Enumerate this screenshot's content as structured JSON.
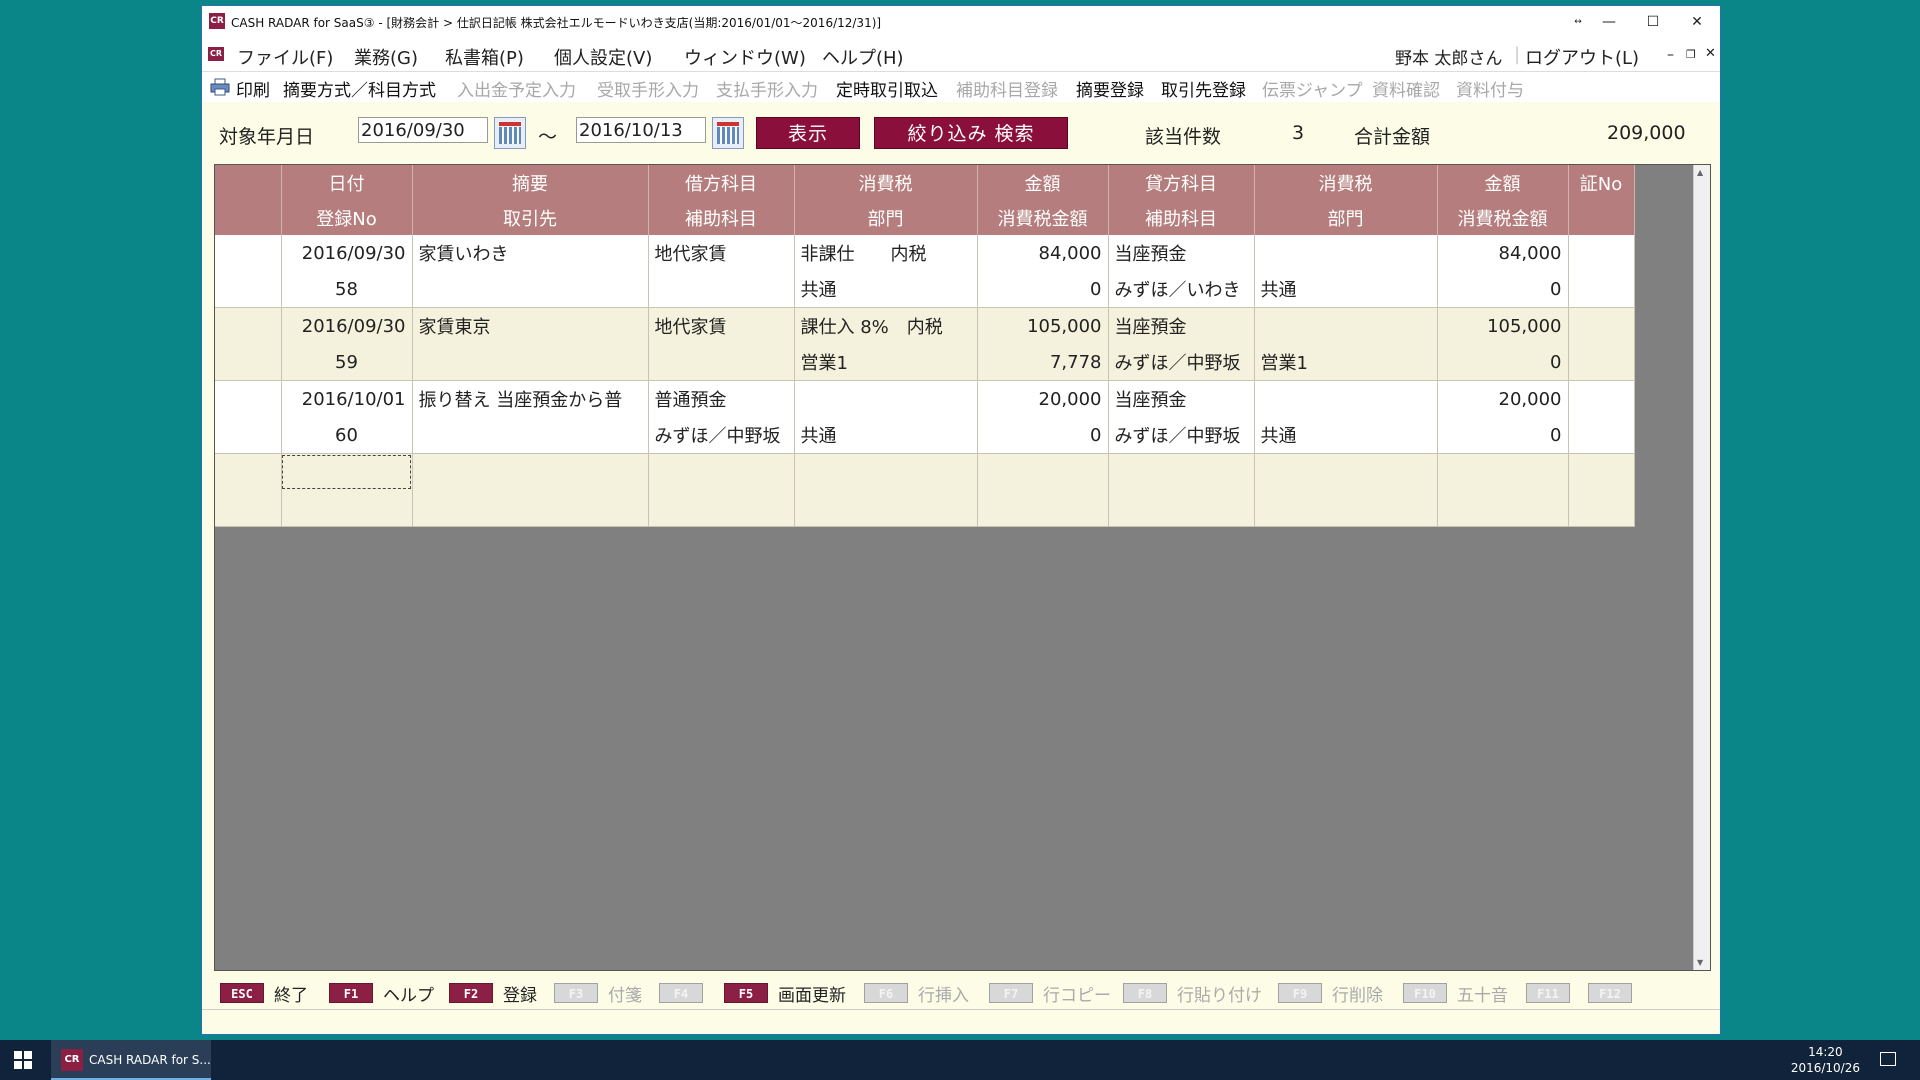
{
  "window": {
    "title": "CASH RADAR for SaaS③ - [財務会計 > 仕訳日記帳 株式会社エルモードいわき支店(当期:2016/01/01～2016/12/31)]",
    "app_icon": "CR"
  },
  "menu": {
    "items": [
      "ファイル(F)",
      "業務(G)",
      "私書箱(P)",
      "個人設定(V)",
      "ウィンドウ(W)",
      "ヘルプ(H)"
    ],
    "user": "野本 太郎さん",
    "logout": "ログアウト(L)"
  },
  "toolbar": {
    "print": "印刷",
    "items": [
      {
        "label": "摘要方式／科目方式",
        "enabled": true
      },
      {
        "label": "入出金予定入力",
        "enabled": false
      },
      {
        "label": "受取手形入力",
        "enabled": false
      },
      {
        "label": "支払手形入力",
        "enabled": false
      },
      {
        "label": "定時取引取込",
        "enabled": true
      },
      {
        "label": "補助科目登録",
        "enabled": false
      },
      {
        "label": "摘要登録",
        "enabled": true
      },
      {
        "label": "取引先登録",
        "enabled": true
      },
      {
        "label": "伝票ジャンプ",
        "enabled": false
      },
      {
        "label": "資料確認",
        "enabled": false
      },
      {
        "label": "資料付与",
        "enabled": false
      }
    ]
  },
  "filter": {
    "label": "対象年月日",
    "from": "2016/09/30",
    "tilde": "～",
    "to": "2016/10/13",
    "show_button": "表示",
    "search_button": "絞り込み 検索",
    "count_label": "該当件数",
    "count_value": "3",
    "total_label": "合計金額",
    "total_value": "209,000"
  },
  "table": {
    "header_top": [
      "",
      "日付",
      "摘要",
      "借方科目",
      "消費税",
      "金額",
      "貸方科目",
      "消費税",
      "金額",
      "証No"
    ],
    "header_bottom": [
      "",
      "登録No",
      "取引先",
      "補助科目",
      "部門",
      "消費税金額",
      "補助科目",
      "部門",
      "消費税金額",
      ""
    ],
    "rows": [
      {
        "top": [
          "",
          "2016/09/30",
          "家賃いわき",
          "地代家賃",
          "非課仕　　内税",
          "84,000",
          "当座預金",
          "",
          "84,000",
          ""
        ],
        "bottom": [
          "",
          "58",
          "",
          "",
          "共通",
          "0",
          "みずほ／いわき",
          "共通",
          "0",
          ""
        ]
      },
      {
        "top": [
          "",
          "2016/09/30",
          "家賃東京",
          "地代家賃",
          "課仕入 8%　内税",
          "105,000",
          "当座預金",
          "",
          "105,000",
          ""
        ],
        "bottom": [
          "",
          "59",
          "",
          "",
          "営業1",
          "7,778",
          "みずほ／中野坂",
          "営業1",
          "0",
          ""
        ]
      },
      {
        "top": [
          "",
          "2016/10/01",
          "振り替え 当座預金から普",
          "普通預金",
          "",
          "20,000",
          "当座預金",
          "",
          "20,000",
          ""
        ],
        "bottom": [
          "",
          "60",
          "",
          "みずほ／中野坂",
          "共通",
          "0",
          "みずほ／中野坂",
          "共通",
          "0",
          ""
        ]
      }
    ]
  },
  "fkeys": [
    {
      "key": "ESC",
      "label": "終了",
      "enabled": true
    },
    {
      "key": "F1",
      "label": "ヘルプ",
      "enabled": true
    },
    {
      "key": "F2",
      "label": "登録",
      "enabled": true
    },
    {
      "key": "F3",
      "label": "付箋",
      "enabled": false
    },
    {
      "key": "F4",
      "label": "",
      "enabled": false
    },
    {
      "key": "F5",
      "label": "画面更新",
      "enabled": true
    },
    {
      "key": "F6",
      "label": "行挿入",
      "enabled": false
    },
    {
      "key": "F7",
      "label": "行コピー",
      "enabled": false
    },
    {
      "key": "F8",
      "label": "行貼り付け",
      "enabled": false
    },
    {
      "key": "F9",
      "label": "行削除",
      "enabled": false
    },
    {
      "key": "F10",
      "label": "五十音",
      "enabled": false
    },
    {
      "key": "F11",
      "label": "",
      "enabled": false
    },
    {
      "key": "F12",
      "label": "",
      "enabled": false
    }
  ],
  "taskbar": {
    "app_label": "CASH RADAR for S...",
    "app_icon": "CR",
    "time": "14:20",
    "date": "2016/10/26"
  },
  "colors": {
    "accent": "#8b0f3b",
    "header": "#b57d7d",
    "desktop": "#0a8688",
    "row_alt": "#f4f2dc"
  }
}
